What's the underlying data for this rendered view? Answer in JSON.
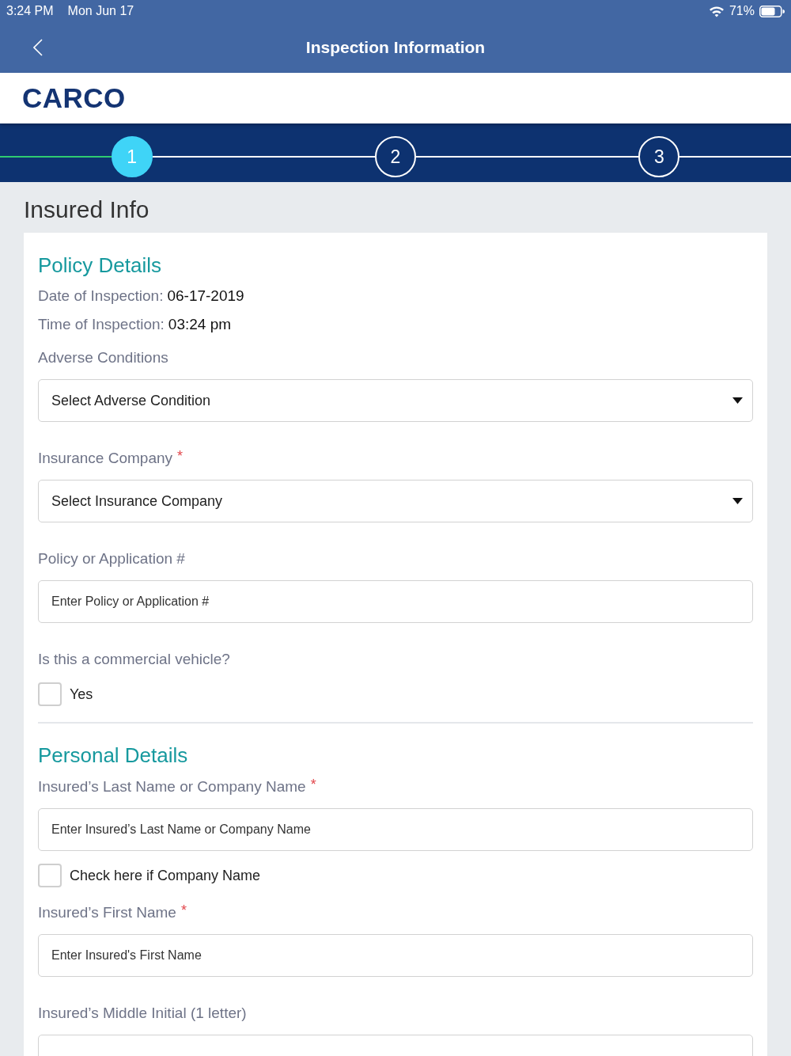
{
  "status_bar": {
    "time": "3:24 PM",
    "date": "Mon Jun 17",
    "battery": "71%"
  },
  "nav_bar": {
    "title": "Inspection Information"
  },
  "logo": {
    "text": "CARCO"
  },
  "stepper": {
    "steps": [
      {
        "label": "1",
        "selected": true
      },
      {
        "label": "2",
        "selected": false
      },
      {
        "label": "3",
        "selected": false
      }
    ]
  },
  "page_title": "Insured Info",
  "sections": [
    {
      "title": "Policy Details",
      "info": [
        {
          "label": "Date of Inspection:",
          "value": "06-17-2019"
        },
        {
          "label": "Time of Inspection:",
          "value": "03:24 pm"
        }
      ],
      "fields": [
        {
          "kind": "select",
          "label": "Adverse Conditions",
          "placeholder": "Select Adverse Condition"
        },
        {
          "kind": "select",
          "label": "Insurance Company",
          "required_mark": "*",
          "placeholder": "Select Insurance Company"
        },
        {
          "kind": "input",
          "label": "Policy or Application #",
          "placeholder": "Enter Policy or Application #"
        },
        {
          "kind": "checkbox_question",
          "label": "Is this a commercial vehicle?",
          "option": "Yes",
          "checked": false
        }
      ]
    },
    {
      "title": "Personal Details",
      "fields": [
        {
          "kind": "input",
          "label": "Insured’s Last Name or Company Name",
          "required_mark": "*",
          "placeholder": "Enter Insured’s Last Name or Company Name"
        },
        {
          "kind": "checkbox",
          "option": "Check here if Company Name",
          "checked": false
        },
        {
          "kind": "input",
          "label": "Insured’s First Name",
          "required_mark": "*",
          "placeholder": "Enter Insured's First Name"
        },
        {
          "kind": "input",
          "label": "Insured’s Middle Initial (1 letter)"
        }
      ]
    }
  ]
}
